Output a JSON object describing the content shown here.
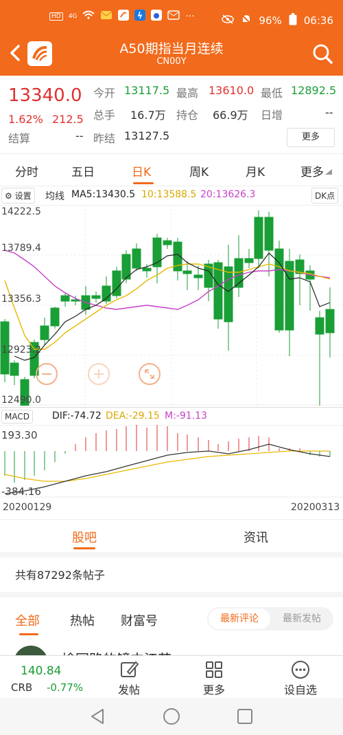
{
  "status_bar": {
    "left_badges": [
      "HD",
      "4G"
    ],
    "battery": "96%",
    "time": "06:36"
  },
  "header": {
    "title": "A50期指当月连续",
    "subtitle": "CN00Y"
  },
  "quote": {
    "price": "13340.0",
    "pct": "1.62%",
    "change": "212.5",
    "fields": [
      {
        "label": "今开",
        "value": "13117.5",
        "color": "green"
      },
      {
        "label": "最高",
        "value": "13610.0",
        "color": "red"
      },
      {
        "label": "最低",
        "value": "12892.5",
        "color": "green"
      },
      {
        "label": "总手",
        "value": "16.7万",
        "color": "none"
      },
      {
        "label": "持仓",
        "value": "66.9万",
        "color": "none"
      },
      {
        "label": "日增",
        "value": "--",
        "color": "none"
      },
      {
        "label": "结算",
        "value": "--",
        "color": "none"
      },
      {
        "label": "昨结",
        "value": "13127.5",
        "color": "none"
      }
    ],
    "more_label": "更多"
  },
  "period_tabs": {
    "items": [
      "分时",
      "五日",
      "日K",
      "周K",
      "月K",
      "更多"
    ],
    "active_index": 2
  },
  "kline": {
    "settings_label": "设置",
    "ma_label": "均线",
    "ma5": "MA5:13430.5",
    "ma10": "10:13588.5",
    "ma20": "20:13626.3",
    "dk_label": "DK点",
    "y_labels": [
      "14222.5",
      "13789.4",
      "13356.3",
      "12923.2",
      "12490.0"
    ],
    "macd_label": "MACD",
    "dif": "DIF:-74.72",
    "dea": "DEA:-29.15",
    "m": "M:-91.13",
    "macd_top": "193.30",
    "macd_bottom": "-384.16",
    "date_start": "20200129",
    "date_end": "20200313",
    "colors": {
      "up": "#e0302e",
      "down": "#1a9e36",
      "ma5": "#222222",
      "ma10": "#e8b800",
      "ma20": "#c63fc6"
    }
  },
  "section_tabs": {
    "items": [
      "股吧",
      "资讯"
    ],
    "active_index": 0
  },
  "posts_count": "共有87292条帖子",
  "sub_tabs": {
    "items": [
      "全部",
      "热帖",
      "财富号"
    ],
    "active_index": 0,
    "sort_on": "最新评论",
    "sort_off": "最新发帖"
  },
  "peek_text": "榆园路的镜中江若",
  "bottom_bar": {
    "ticker_value": "140.84",
    "ticker_name": "CRB",
    "ticker_change": "-0.77%",
    "items": [
      {
        "label": "发帖",
        "icon": "edit-icon"
      },
      {
        "label": "更多",
        "icon": "grid-icon"
      },
      {
        "label": "设自选",
        "icon": "more-dots-icon"
      }
    ]
  }
}
